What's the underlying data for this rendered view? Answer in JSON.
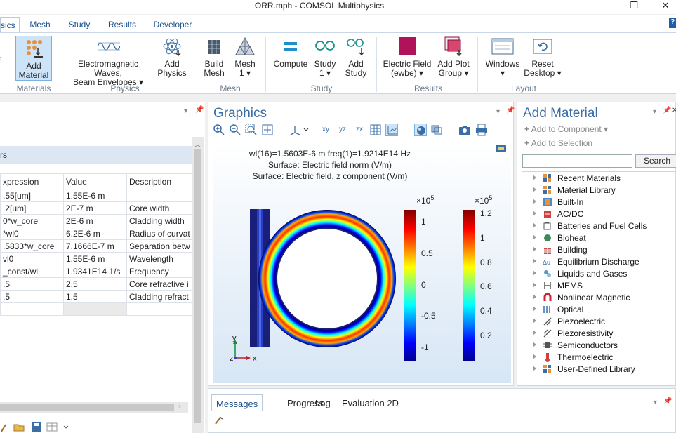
{
  "window": {
    "title": "ORR.mph - COMSOL Multiphysics",
    "minimize": "—",
    "maximize": "❐",
    "close": "✕"
  },
  "tabs": [
    {
      "label": "sics"
    },
    {
      "label": "Mesh"
    },
    {
      "label": "Study"
    },
    {
      "label": "Results"
    },
    {
      "label": "Developer"
    }
  ],
  "help_label": "?",
  "ribbon": {
    "add_material": "Add\nMaterial",
    "ewbe": "Electromagnetic Waves,\nBeam Envelopes ▾",
    "add_physics": "Add\nPhysics",
    "build_mesh": "Build\nMesh",
    "mesh1": "Mesh\n1 ▾",
    "compute": "Compute",
    "study1": "Study\n1 ▾",
    "add_study": "Add\nStudy",
    "electric_field": "Electric Field\n(ewbe) ▾",
    "add_plot_group": "Add Plot\nGroup ▾",
    "windows": "Windows\n▾",
    "reset_desktop": "Reset\nDesktop ▾",
    "groups": [
      "Materials",
      "Physics",
      "Mesh",
      "Study",
      "Results",
      "Layout"
    ]
  },
  "params": {
    "band_label": "rs",
    "headers": [
      "xpression",
      "Value",
      "Description"
    ],
    "rows": [
      [
        ".55[um]",
        "1.55E-6 m",
        ""
      ],
      [
        ".2[um]",
        "2E-7 m",
        "Core width"
      ],
      [
        "0*w_core",
        "2E-6 m",
        "Cladding width"
      ],
      [
        "*wl0",
        "6.2E-6 m",
        "Radius of curvat"
      ],
      [
        ".5833*w_core",
        "7.1666E-7 m",
        "Separation betw"
      ],
      [
        "vl0",
        "1.55E-6 m",
        "Wavelength"
      ],
      [
        "_const/wl",
        "1.9341E14 1/s",
        "Frequency"
      ],
      [
        ".5",
        "2.5",
        "Core refractive i"
      ],
      [
        ".5",
        "1.5",
        "Cladding refract"
      ],
      [
        "",
        "",
        ""
      ]
    ]
  },
  "graphics": {
    "title": "Graphics",
    "plot_line1": "wl(16)=1.5603E-6 m freq(1)=1.9214E14 Hz",
    "plot_line2": "Surface: Electric field norm (V/m)",
    "plot_line3": "Surface: Electric field, z component (V/m)",
    "axis_y": "y",
    "axis_z": "z",
    "axis_x": "x",
    "cb1_mult": "×10",
    "cb1_exp": "5",
    "cb1_ticks": [
      "1",
      "0.5",
      "0",
      "-0.5",
      "-1"
    ],
    "cb2_mult": "×10",
    "cb2_exp": "5",
    "cb2_ticks": [
      "1.2",
      "1",
      "0.8",
      "0.6",
      "0.4",
      "0.2"
    ]
  },
  "add_material": {
    "title": "Add Material",
    "add_to_component": "Add to Component ▾",
    "add_to_selection": "Add to Selection",
    "search_value": "",
    "search_button": "Search",
    "tree": [
      "Recent Materials",
      "Material Library",
      "Built-In",
      "AC/DC",
      "Batteries and Fuel Cells",
      "Bioheat",
      "Building",
      "Equilibrium Discharge",
      "Liquids and Gases",
      "MEMS",
      "Nonlinear Magnetic",
      "Optical",
      "Piezoelectric",
      "Piezoresistivity",
      "Semiconductors",
      "Thermoelectric",
      "User-Defined Library"
    ]
  },
  "messages": {
    "tabs": [
      "Messages",
      "Progress",
      "Log",
      "Evaluation 2D"
    ]
  },
  "colors": {
    "accent": "#3a6ea5",
    "ribbon_selected": "#cde3f7"
  }
}
